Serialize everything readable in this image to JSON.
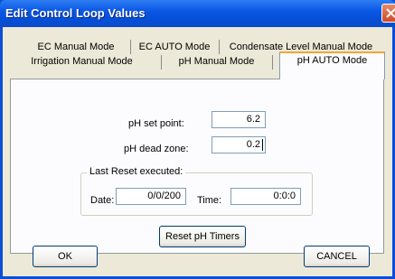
{
  "window": {
    "title": "Edit Control Loop Values"
  },
  "tabs": {
    "row_top": [
      "EC Manual Mode",
      "EC AUTO Mode",
      "Condensate Level Manual Mode"
    ],
    "row_bottom": [
      "Irrigation Manual Mode",
      "pH Manual Mode",
      "pH AUTO Mode"
    ],
    "selected": "pH AUTO Mode"
  },
  "form": {
    "setpoint_label": "pH set point:",
    "setpoint_value": "6.2",
    "deadzone_label": "pH dead zone:",
    "deadzone_value": "0.2",
    "reset_group_title": "Last Reset executed:",
    "date_label": "Date:",
    "date_value": "0/0/200",
    "time_label": "Time:",
    "time_value": "0:0:0",
    "reset_button": "Reset pH Timers"
  },
  "buttons": {
    "ok": "OK",
    "cancel": "CANCEL"
  },
  "colors": {
    "titlebar": "#0a58e6",
    "dialog_bg": "#ece9d8",
    "tab_highlight": "#f1a733",
    "close_button": "#d04a24"
  },
  "icons": {
    "close": "close-x-icon"
  }
}
